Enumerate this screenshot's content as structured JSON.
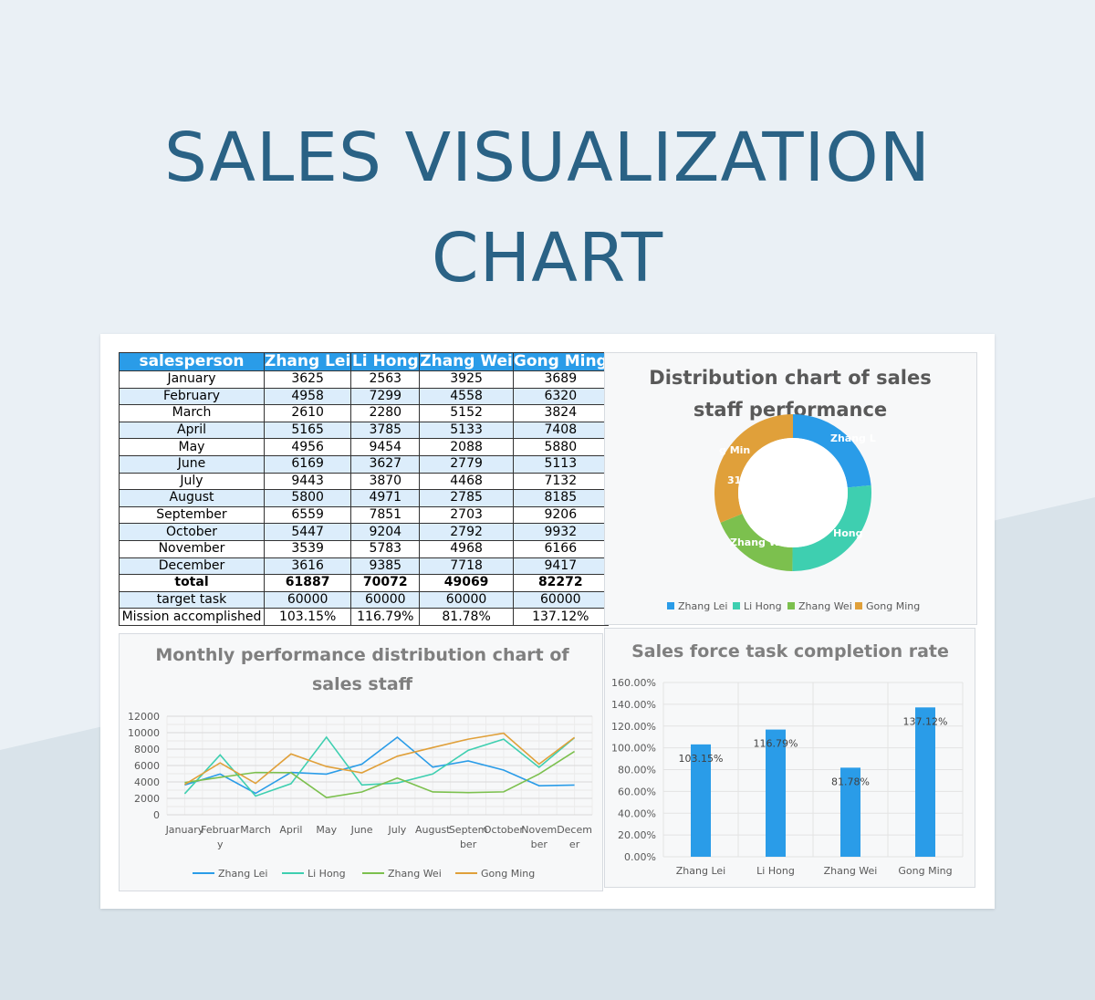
{
  "title_line1": "SALES VISUALIZATION",
  "title_line2": "CHART",
  "table": {
    "headers": [
      "salesperson",
      "Zhang Lei",
      "Li Hong",
      "Zhang Wei",
      "Gong Ming"
    ],
    "rows": [
      [
        "January",
        "3625",
        "2563",
        "3925",
        "3689"
      ],
      [
        "February",
        "4958",
        "7299",
        "4558",
        "6320"
      ],
      [
        "March",
        "2610",
        "2280",
        "5152",
        "3824"
      ],
      [
        "April",
        "5165",
        "3785",
        "5133",
        "7408"
      ],
      [
        "May",
        "4956",
        "9454",
        "2088",
        "5880"
      ],
      [
        "June",
        "6169",
        "3627",
        "2779",
        "5113"
      ],
      [
        "July",
        "9443",
        "3870",
        "4468",
        "7132"
      ],
      [
        "August",
        "5800",
        "4971",
        "2785",
        "8185"
      ],
      [
        "September",
        "6559",
        "7851",
        "2703",
        "9206"
      ],
      [
        "October",
        "5447",
        "9204",
        "2792",
        "9932"
      ],
      [
        "November",
        "3539",
        "5783",
        "4968",
        "6166"
      ],
      [
        "December",
        "3616",
        "9385",
        "7718",
        "9417"
      ],
      [
        "total",
        "61887",
        "70072",
        "49069",
        "82272"
      ],
      [
        "target task",
        "60000",
        "60000",
        "60000",
        "60000"
      ],
      [
        "Mission accomplished",
        "103.15%",
        "116.79%",
        "81.78%",
        "137.12%"
      ]
    ]
  },
  "colors": {
    "Zhang Lei": "#2a9ce8",
    "Li Hong": "#3ecfb0",
    "Zhang Wei": "#7cc04e",
    "Gong Ming": "#e0a03a",
    "bar": "#2a9ce8",
    "title": "#2a6285"
  },
  "chart_data": [
    {
      "type": "pie",
      "subtype": "donut",
      "title": "Distribution chart of sales staff performance",
      "categories": [
        "Zhang Lei",
        "Li Hong",
        "Zhang Wei",
        "Gong Ming"
      ],
      "values": [
        61887,
        70072,
        49069,
        82272
      ],
      "visible_slice_labels": [
        "Zhang L",
        "%",
        "Hong",
        "Zhang W",
        "g Min",
        "31"
      ],
      "legend_position": "bottom"
    },
    {
      "type": "line",
      "title": "Monthly performance distribution chart of sales staff",
      "categories": [
        "January",
        "February",
        "March",
        "April",
        "May",
        "June",
        "July",
        "August",
        "September",
        "October",
        "November",
        "December"
      ],
      "x_tick_labels": [
        [
          "January"
        ],
        [
          "Februar",
          "y"
        ],
        [
          "March"
        ],
        [
          "April"
        ],
        [
          "May"
        ],
        [
          "June"
        ],
        [
          "July"
        ],
        [
          "August"
        ],
        [
          "Septem",
          "ber"
        ],
        [
          "October"
        ],
        [
          "Novem",
          "ber"
        ],
        [
          "Decem",
          "er"
        ]
      ],
      "series": [
        {
          "name": "Zhang Lei",
          "values": [
            3625,
            4958,
            2610,
            5165,
            4956,
            6169,
            9443,
            5800,
            6559,
            5447,
            3539,
            3616
          ]
        },
        {
          "name": "Li Hong",
          "values": [
            2563,
            7299,
            2280,
            3785,
            9454,
            3627,
            3870,
            4971,
            7851,
            9204,
            5783,
            9385
          ]
        },
        {
          "name": "Zhang Wei",
          "values": [
            3925,
            4558,
            5152,
            5133,
            2088,
            2779,
            4468,
            2785,
            2703,
            2792,
            4968,
            7718
          ]
        },
        {
          "name": "Gong Ming",
          "values": [
            3689,
            6320,
            3824,
            7408,
            5880,
            5113,
            7132,
            8185,
            9206,
            9932,
            6166,
            9417
          ]
        }
      ],
      "y_ticks": [
        "0",
        "2000",
        "4000",
        "6000",
        "8000",
        "10000",
        "12000"
      ],
      "ylim": [
        0,
        12000
      ],
      "grid": true,
      "legend_position": "bottom"
    },
    {
      "type": "bar",
      "title": "Sales force task completion rate",
      "categories": [
        "Zhang Lei",
        "Li Hong",
        "Zhang Wei",
        "Gong Ming"
      ],
      "values": [
        103.15,
        116.79,
        81.78,
        137.12
      ],
      "data_labels": [
        "103.15%",
        "116.79%",
        "81.78%",
        "137.12%"
      ],
      "y_ticks": [
        "0.00%",
        "20.00%",
        "40.00%",
        "60.00%",
        "80.00%",
        "100.00%",
        "120.00%",
        "140.00%",
        "160.00%"
      ],
      "ylim": [
        0,
        160
      ],
      "grid": true
    }
  ]
}
